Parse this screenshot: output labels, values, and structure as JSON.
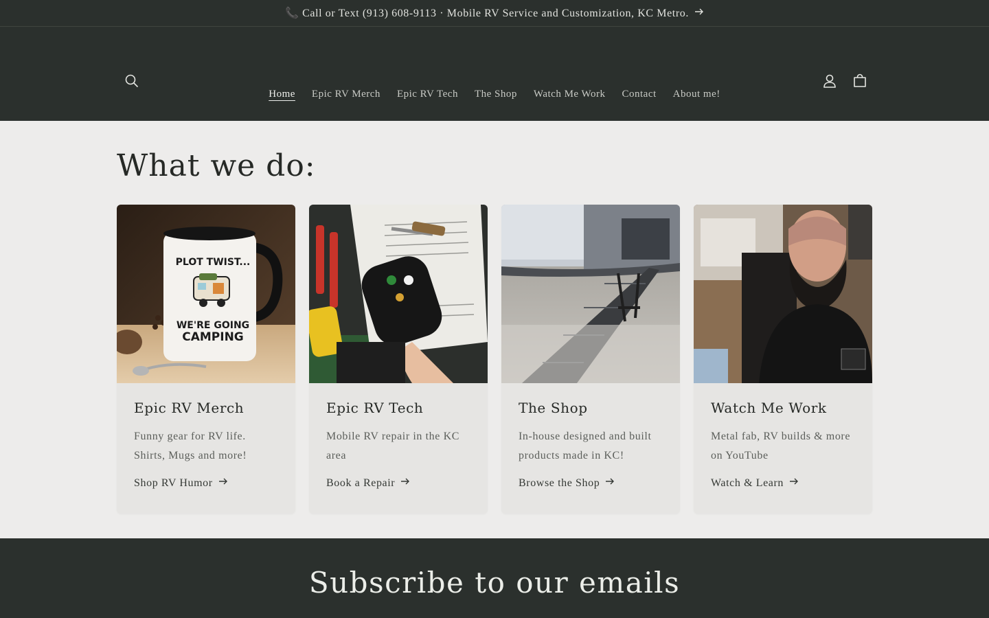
{
  "announcement": {
    "icon": "phone-icon",
    "text": "📞 Call or Text (913) 608-9113 · Mobile RV Service and Customization, KC Metro."
  },
  "header": {
    "nav": [
      {
        "label": "Home",
        "active": true
      },
      {
        "label": "Epic RV Merch"
      },
      {
        "label": "Epic RV Tech"
      },
      {
        "label": "The Shop"
      },
      {
        "label": "Watch Me Work"
      },
      {
        "label": "Contact"
      },
      {
        "label": "About me!"
      }
    ],
    "icons": [
      "search-icon",
      "account-icon",
      "cart-icon"
    ]
  },
  "section": {
    "title": "What we do:",
    "cards": [
      {
        "title": "Epic RV Merch",
        "desc": "Funny gear for RV life. Shirts, Mugs and more!",
        "link": "Shop RV Humor",
        "image": "camper mug",
        "mug_top": "PLOT TWIST...",
        "mug_bottom1": "WE'RE GOING",
        "mug_bottom2": "CAMPING"
      },
      {
        "title": "Epic RV Tech",
        "desc": "Mobile RV repair in the KC area",
        "link": "Book a Repair",
        "image": "rv plug repair"
      },
      {
        "title": "The Shop",
        "desc": "In-house designed and built products made in KC!",
        "link": "Browse the Shop",
        "image": "truck ramp"
      },
      {
        "title": "Watch Me Work",
        "desc": "Metal fab, RV builds & more on YouTube",
        "link": "Watch & Learn",
        "image": "man in rv"
      }
    ]
  },
  "subscribe": {
    "title": "Subscribe to our emails"
  },
  "colors": {
    "dark": "#2b302d",
    "page_bg": "#edeceb",
    "card_bg": "#e6e5e3"
  }
}
